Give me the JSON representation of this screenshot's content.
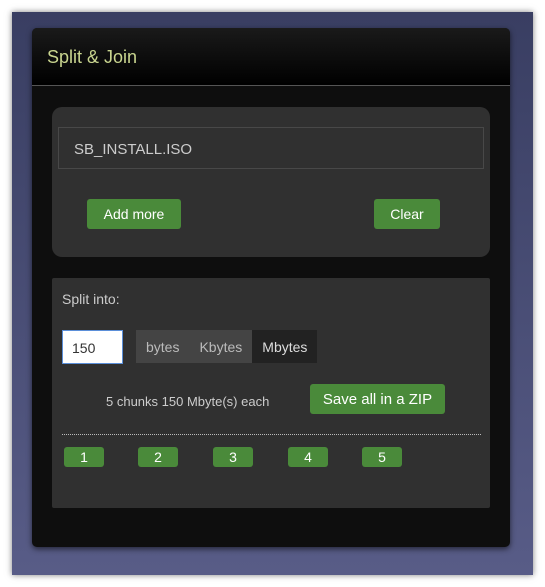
{
  "app": {
    "title": "Split & Join"
  },
  "files": {
    "items": [
      "SB_INSTALL.ISO"
    ],
    "add_more": "Add more",
    "clear": "Clear"
  },
  "split": {
    "label": "Split into:",
    "value": "150",
    "units": [
      "bytes",
      "Kbytes",
      "Mbytes"
    ],
    "selected_unit": "Mbytes",
    "summary": "5 chunks 150 Mbyte(s) each",
    "save_zip": "Save all in a ZIP",
    "chunks": [
      "1",
      "2",
      "3",
      "4",
      "5"
    ]
  },
  "colors": {
    "accent": "#4a8a3a",
    "title": "#c9d58f"
  }
}
